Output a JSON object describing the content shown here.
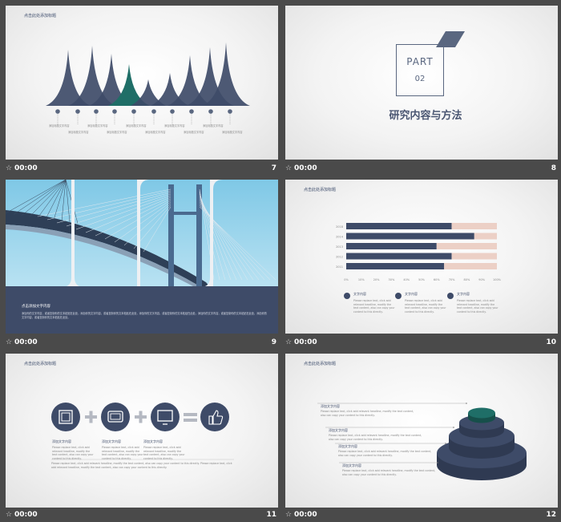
{
  "slides": [
    {
      "num": "7",
      "time": "00:00",
      "title": "点击此处添加标题",
      "labels": [
        "添加标题文字内容",
        "添加标题文字内容",
        "添加标题文字内容",
        "添加标题文字内容",
        "添加标题文字内容",
        "添加标题文字内容",
        "添加标题文字内容",
        "添加标题文字内容",
        "添加标题文字内容",
        "添加标题文字内容"
      ]
    },
    {
      "num": "8",
      "time": "00:00",
      "part": "PART",
      "part_num": "02",
      "heading": "研究内容与方法"
    },
    {
      "num": "9",
      "time": "00:00",
      "band_title": "点击添加文字内容",
      "band_text": "添加你的文字内容，或者复制你的文本粘贴在此处，添加你的文字内容，或者复制你的文本粘贴在此处，添加你的文字内容，或者复制你的文本粘贴在此处，添加你的文字内容，或者复制你的文本粘贴在此处，添加你的文字内容，或者复制你的文本粘贴在此处。"
    },
    {
      "num": "10",
      "time": "00:00",
      "title": "点击此处添加标题",
      "legend": [
        "文字内容",
        "文字内容",
        "文字内容"
      ],
      "legend_text": "Please replace text, click add relevant headline, modify the text content, also can copy your content to this directly."
    },
    {
      "num": "11",
      "time": "00:00",
      "title": "点击此处添加标题",
      "labels": [
        "添加文字内容",
        "添加文字内容",
        "添加文字内容"
      ],
      "desc": "Please replace text, click add relevant headline, modify the text content, also can copy your content to this directly.",
      "footer": "Please replace text, click add relevant headline, modify the text content, also can copy your content to this directly. Please replace text, click add relevant headline, modify the text content, also can copy your content to this directly."
    },
    {
      "num": "12",
      "time": "00:00",
      "title": "点击此处添加标题",
      "labels": [
        "添加文字内容",
        "添加文字内容",
        "添加文字内容",
        "添加文字内容"
      ],
      "desc": "Please replace text, click add relevant headline, modify the text content, also can copy your content to this directly."
    }
  ],
  "chart_data": {
    "type": "bar",
    "orientation": "horizontal",
    "stacked_to": 100,
    "categories": [
      "2018",
      "2014",
      "2013",
      "2012",
      "2011"
    ],
    "series": [
      {
        "values": [
          70,
          85,
          60,
          70,
          65
        ],
        "color": "#3e4b68"
      },
      {
        "values": [
          30,
          15,
          40,
          30,
          35
        ],
        "color": "#ecd0c6"
      }
    ],
    "xticks": [
      "0%",
      "10%",
      "20%",
      "30%",
      "40%",
      "50%",
      "60%",
      "70%",
      "80%",
      "90%",
      "100%"
    ],
    "xlim": [
      0,
      100
    ]
  },
  "colors": {
    "navy": "#3e4b68",
    "teal": "#1f6e67",
    "peach": "#ecd0c6",
    "frame": "#4a4a4a"
  }
}
